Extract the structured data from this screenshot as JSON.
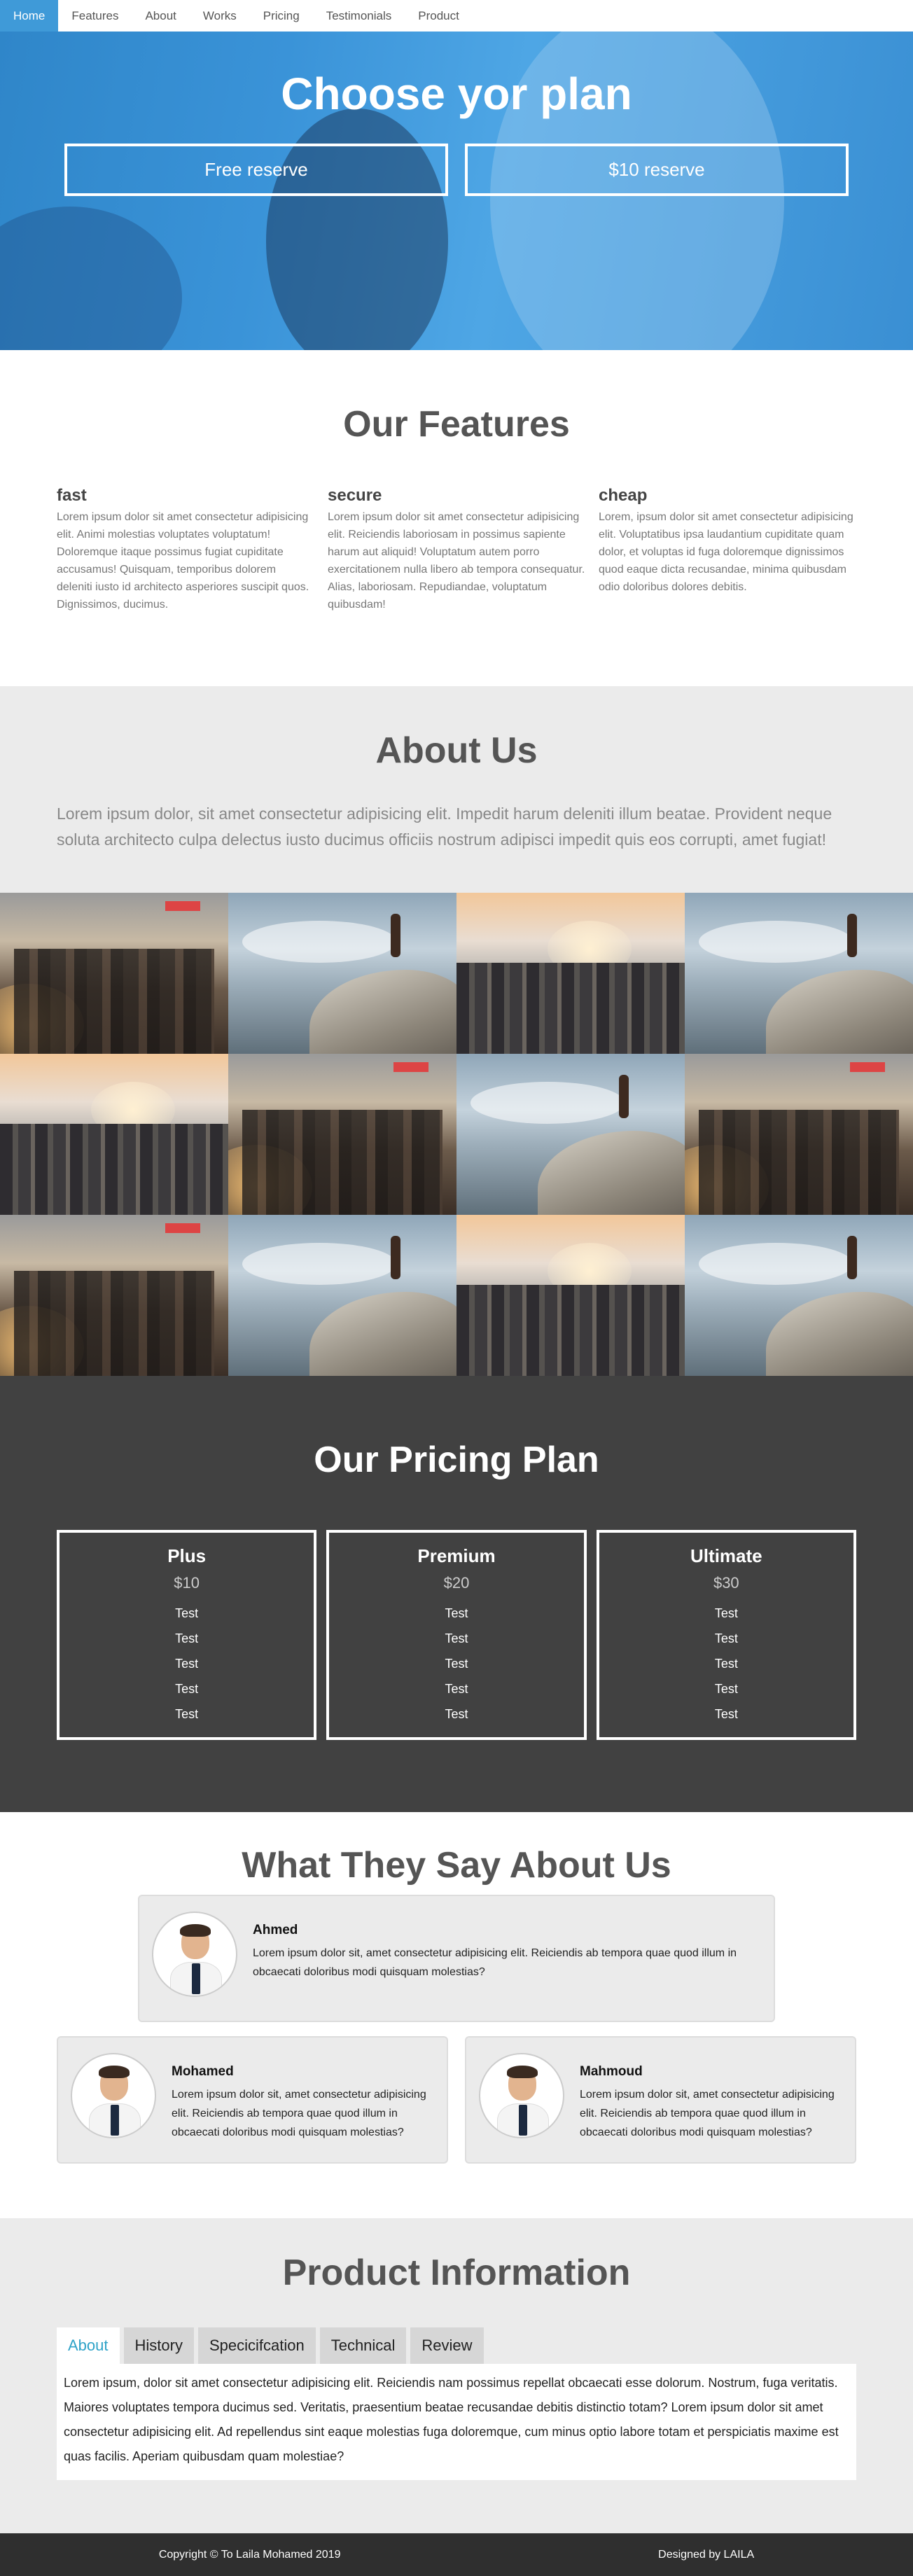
{
  "nav": {
    "items": [
      {
        "label": "Home",
        "active": true
      },
      {
        "label": "Features"
      },
      {
        "label": "About"
      },
      {
        "label": "Works"
      },
      {
        "label": "Pricing"
      },
      {
        "label": "Testimonials"
      },
      {
        "label": "Product"
      }
    ]
  },
  "hero": {
    "title": "Choose yor plan",
    "buttons": [
      "Free reserve",
      "$10 reserve"
    ],
    "overlay_color": "#3a93d8"
  },
  "features": {
    "title": "Our Features",
    "items": [
      {
        "title": "fast",
        "text": "Lorem ipsum dolor sit amet consectetur adipisicing elit. Animi molestias voluptates voluptatum! Doloremque itaque possimus fugiat cupiditate accusamus! Quisquam, temporibus dolorem deleniti iusto id architecto asperiores suscipit quos. Dignissimos, ducimus."
      },
      {
        "title": "secure",
        "text": "Lorem ipsum dolor sit amet consectetur adipisicing elit. Reiciendis laboriosam in possimus sapiente harum aut aliquid! Voluptatum autem porro exercitationem nulla libero ab tempora consequatur. Alias, laboriosam. Repudiandae, voluptatum quibusdam!"
      },
      {
        "title": "cheap",
        "text": "Lorem, ipsum dolor sit amet consectetur adipisicing elit. Voluptatibus ipsa laudantium cupiditate quam dolor, et voluptas id fuga doloremque dignissimos quod eaque dicta recusandae, minima quibusdam odio doloribus dolores debitis."
      }
    ]
  },
  "about": {
    "title": "About Us",
    "text": "Lorem ipsum dolor, sit amet consectetur adipisicing elit. Impedit harum deleniti illum beatae. Provident neque soluta architecto culpa delectus iusto ducimus officiis nostrum adipisci impedit quis eos corrupti, amet fugiat!"
  },
  "gallery": {
    "images": [
      "crowd",
      "rock",
      "city",
      "rock",
      "city",
      "crowd",
      "rock",
      "crowd",
      "crowd",
      "rock",
      "city",
      "rock"
    ]
  },
  "pricing": {
    "title": "Our Pricing Plan",
    "plans": [
      {
        "name": "Plus",
        "price": "$10",
        "features": [
          "Test",
          "Test",
          "Test",
          "Test",
          "Test"
        ]
      },
      {
        "name": "Premium",
        "price": "$20",
        "features": [
          "Test",
          "Test",
          "Test",
          "Test",
          "Test"
        ]
      },
      {
        "name": "Ultimate",
        "price": "$30",
        "features": [
          "Test",
          "Test",
          "Test",
          "Test",
          "Test"
        ]
      }
    ]
  },
  "testimonials": {
    "title": "What They Say About Us",
    "items": [
      {
        "name": "Ahmed",
        "text": "Lorem ipsum dolor sit, amet consectetur adipisicing elit. Reiciendis ab tempora quae quod illum in obcaecati doloribus modi quisquam molestias?"
      },
      {
        "name": "Mohamed",
        "text": "Lorem ipsum dolor sit, amet consectetur adipisicing elit. Reiciendis ab tempora quae quod illum in obcaecati doloribus modi quisquam molestias?"
      },
      {
        "name": "Mahmoud",
        "text": "Lorem ipsum dolor sit, amet consectetur adipisicing elit. Reiciendis ab tempora quae quod illum in obcaecati doloribus modi quisquam molestias?"
      }
    ]
  },
  "product": {
    "title": "Product Information",
    "tabs": [
      {
        "label": "About",
        "active": true
      },
      {
        "label": "History"
      },
      {
        "label": "Specicifcation"
      },
      {
        "label": "Technical"
      },
      {
        "label": "Review"
      }
    ],
    "panel_text": "Lorem ipsum, dolor sit amet consectetur adipisicing elit. Reiciendis nam possimus repellat obcaecati esse dolorum. Nostrum, fuga veritatis. Maiores voluptates tempora ducimus sed. Veritatis, praesentium beatae recusandae debitis distinctio totam? Lorem ipsum dolor sit amet consectetur adipisicing elit. Ad repellendus sint eaque molestias fuga doloremque, cum minus optio labore totam et perspiciatis maxime est quas facilis. Aperiam quibusdam quam molestiae?"
  },
  "footer": {
    "copyright": "Copyright © To Laila Mohamed 2019",
    "designed_by": "Designed by LAILA"
  },
  "colors": {
    "accent": "#3f9ad8",
    "tab_active_text": "#2fa3c8",
    "dark_section": "#414141",
    "footer": "#2f2f2f",
    "light_section": "#ebebeb"
  }
}
